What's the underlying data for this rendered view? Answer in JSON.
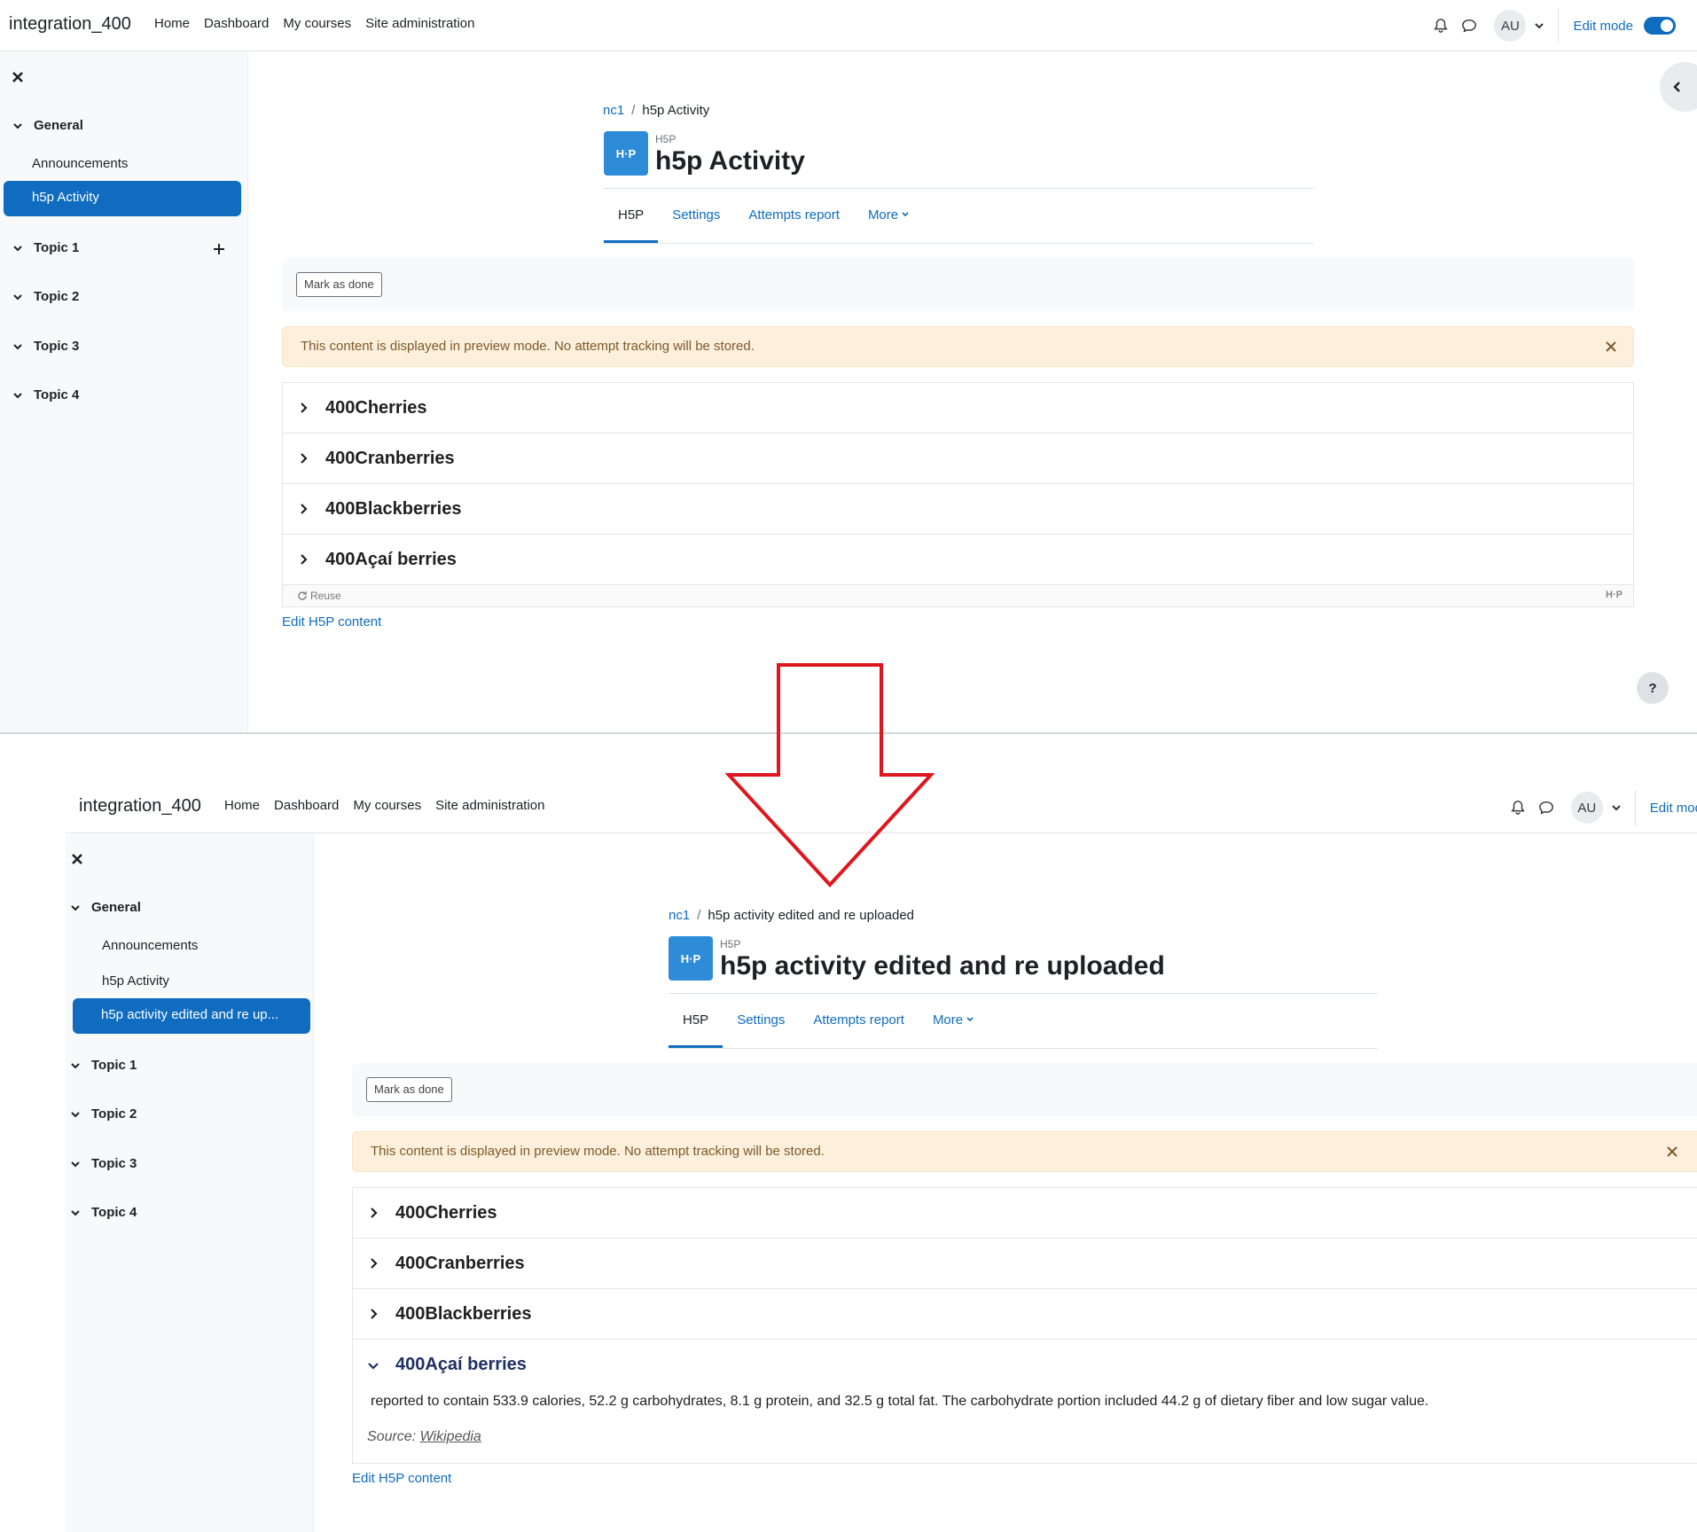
{
  "shot1": {
    "site_name": "integration_400",
    "nav": [
      "Home",
      "Dashboard",
      "My courses",
      "Site administration"
    ],
    "avatar": "AU",
    "edit_mode_label": "Edit mode",
    "drawer": {
      "section_general": "General",
      "items": [
        "Announcements"
      ],
      "active_item": "h5p Activity",
      "topics": [
        "Topic 1",
        "Topic 2",
        "Topic 3",
        "Topic 4"
      ]
    },
    "breadcrumb": [
      "nc1",
      "h5p Activity"
    ],
    "module_type": "H5P",
    "h5p_logo": "H·P",
    "title": "h5p Activity",
    "tabs": [
      "H5P",
      "Settings",
      "Attempts report",
      "More"
    ],
    "mark_done": "Mark as done",
    "alert": "This content is displayed in preview mode. No attempt tracking will be stored.",
    "accordion": [
      "400Cherries",
      "400Cranberries",
      "400Blackberries",
      "400Açaí berries"
    ],
    "reuse": "Reuse",
    "h5p_footer_mark": "H·P",
    "edit_link": "Edit H5P content",
    "help": "?"
  },
  "shot2": {
    "site_name": "integration_400",
    "nav": [
      "Home",
      "Dashboard",
      "My courses",
      "Site administration"
    ],
    "avatar": "AU",
    "edit_mode_label": "Edit mod",
    "drawer": {
      "section_general": "General",
      "items": [
        "Announcements",
        "h5p Activity"
      ],
      "active_item": "h5p activity edited and re up...",
      "topics": [
        "Topic 1",
        "Topic 2",
        "Topic 3",
        "Topic 4"
      ]
    },
    "breadcrumb": [
      "nc1",
      "h5p activity edited and re uploaded"
    ],
    "module_type": "H5P",
    "h5p_logo": "H·P",
    "title": "h5p activity edited and re uploaded",
    "tabs": [
      "H5P",
      "Settings",
      "Attempts report",
      "More"
    ],
    "mark_done": "Mark as done",
    "alert": "This content is displayed in preview mode. No attempt tracking will be stored.",
    "accordion": [
      "400Cherries",
      "400Cranberries",
      "400Blackberries",
      "400Açaí berries"
    ],
    "panel_text": "reported to contain 533.9 calories, 52.2 g carbohydrates, 8.1 g protein, and 32.5 g total fat. The carbohydrate portion included 44.2 g of dietary fiber and low sugar value.",
    "source_label": "Source:",
    "source_link": "Wikipedia",
    "edit_link": "Edit H5P content"
  },
  "colors": {
    "brand": "#0f6cbf",
    "alert_bg": "#fcefdc",
    "arrow": "#e0161e",
    "h5p_tile": "#2e8bd8"
  },
  "icons": [
    "bell-icon",
    "chat-icon",
    "chevron-down-icon",
    "close-icon",
    "chevron-right-icon",
    "plus-move-icon",
    "chevron-left-icon",
    "refresh-icon",
    "arrow-down-icon"
  ]
}
